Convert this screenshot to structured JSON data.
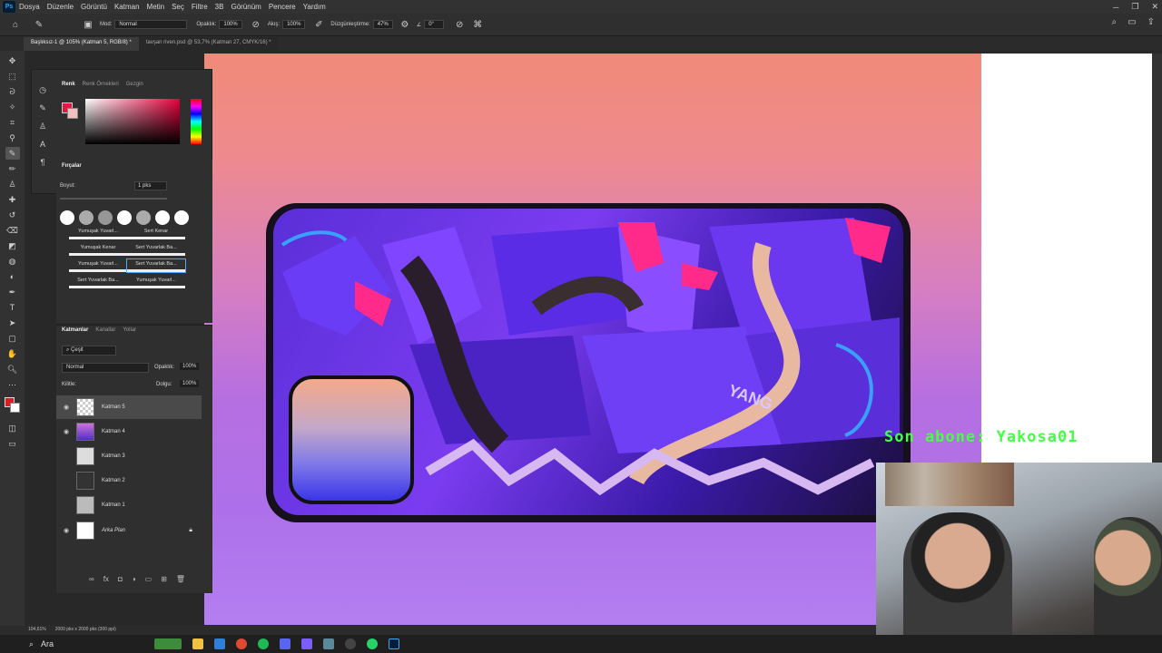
{
  "menubar": {
    "logo": "Ps",
    "items": [
      "Dosya",
      "Düzenle",
      "Görüntü",
      "Katman",
      "Metin",
      "Seç",
      "Filtre",
      "3B",
      "Görünüm",
      "Pencere",
      "Yardım"
    ]
  },
  "options": {
    "mode_label": "Mod:",
    "mode_value": "Normal",
    "opacity_label": "Opaklık:",
    "opacity_value": "100%",
    "flow_label": "Akış:",
    "flow_value": "100%",
    "smoothing_label": "Düzgünleştirme:",
    "smoothing_value": "47%",
    "angle_value": "0°"
  },
  "tabs": [
    {
      "label": "Başlıksız-1 @ 105% (Katman 5, RGB/8) *"
    },
    {
      "label": "tavşan riven.psd @ 53,7% (Katman 27, CMYK/16) *"
    }
  ],
  "color_panel": {
    "tabs": [
      "Renk",
      "Renk Örnekleri",
      "Gezgin"
    ],
    "fg_color": "#e01a44",
    "bg_color": "#f3c0c0"
  },
  "brush_panel": {
    "title": "Fırçalar",
    "size_label": "Boyut:",
    "size_value": "1 pks",
    "presets": [
      "Yumuşak Yuvarl...",
      "Sert Kenar",
      "Yumuşak Kenar",
      "Sert Yuvarlak Ba...",
      "Yumuşak Yuvarl...",
      "Sert Yuvarlak Ba...",
      "Sert Yuvarlak Ba...",
      "Yumuşak Yuvarl..."
    ]
  },
  "layers_panel": {
    "tabs": [
      "Katmanlar",
      "Kanallar",
      "Yollar"
    ],
    "filter_label": "Çeşit",
    "blend_mode": "Normal",
    "opacity_label": "Opaklık:",
    "opacity_value": "100%",
    "lock_label": "Kilitle:",
    "fill_label": "Dolgu:",
    "fill_value": "100%",
    "layers": [
      {
        "name": "Katman 5",
        "visible": true
      },
      {
        "name": "Katman 4",
        "visible": true
      },
      {
        "name": "Katman 3",
        "visible": false
      },
      {
        "name": "Katman 2",
        "visible": false
      },
      {
        "name": "Katman 1",
        "visible": false
      },
      {
        "name": "Arka Plan",
        "visible": true
      }
    ]
  },
  "status": {
    "zoom": "104,61%",
    "doc_info": "2000 pks x 2000 pks (300 ppi)"
  },
  "overlay": {
    "subscriber_text": "Son abone: Yakosa01"
  },
  "taskbar": {
    "search_label": "Ara"
  }
}
